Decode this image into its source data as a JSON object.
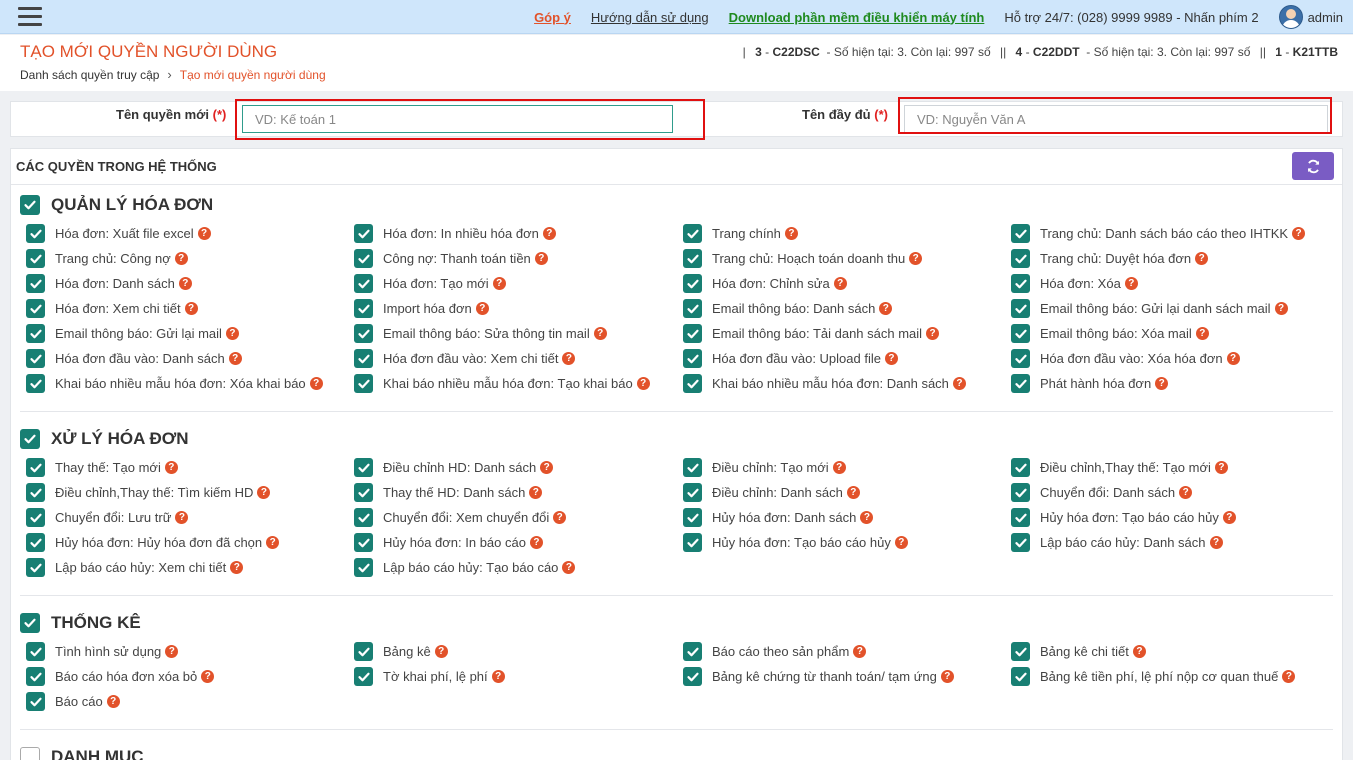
{
  "topbar": {
    "gopy": "Góp ý",
    "huong_dan": "Hướng dẫn sử dụng",
    "download": "Download phần mềm điều khiển máy tính",
    "support": "Hỗ trợ 24/7: (028) 9999 9989 - Nhấn phím 2",
    "user": "admin"
  },
  "header": {
    "title": "Tạo mới quyền người dùng",
    "breadcrumb_home": "Danh sách quyền truy cập",
    "breadcrumb_current": "Tạo mới quyền người dùng",
    "series": [
      {
        "no": "3",
        "code": "C22DSC",
        "info": "- Số hiện tại: 3. Còn lại: 997 số"
      },
      {
        "no": "4",
        "code": "C22DDT",
        "info": "- Số hiện tại: 3. Còn lại: 997 số"
      },
      {
        "no": "1",
        "code": "K21TTB",
        "info": ""
      }
    ]
  },
  "form": {
    "role_label": "Tên quyền mới",
    "role_placeholder": "VD: Kế toán 1",
    "fullname_label": "Tên đầy đủ",
    "fullname_placeholder": "VD: Nguyễn Văn A",
    "required_mark": "(*)"
  },
  "panel": {
    "title": "Các quyền trong hệ thống",
    "groups": [
      {
        "name": "Quản lý hóa đơn",
        "checked": true,
        "items": [
          "Hóa đơn: Xuất file excel",
          "Hóa đơn: In nhiều hóa đơn",
          "Trang chính",
          "Trang chủ: Danh sách báo cáo theo IHTKK",
          "Trang chủ: Công nợ",
          "Công nợ: Thanh toán tiền",
          "Trang chủ: Hoạch toán doanh thu",
          "Trang chủ: Duyệt hóa đơn",
          "Hóa đơn: Danh sách",
          "Hóa đơn: Tạo mới",
          "Hóa đơn: Chỉnh sửa",
          "Hóa đơn: Xóa",
          "Hóa đơn: Xem chi tiết",
          "Import hóa đơn",
          "Email thông báo: Danh sách",
          "Email thông báo: Gửi lại danh sách mail",
          "Email thông báo: Gửi lại mail",
          "Email thông báo: Sửa thông tin mail",
          "Email thông báo: Tải danh sách mail",
          "Email thông báo: Xóa mail",
          "Hóa đơn đầu vào: Danh sách",
          "Hóa đơn đầu vào: Xem chi tiết",
          "Hóa đơn đầu vào: Upload file",
          "Hóa đơn đầu vào: Xóa hóa đơn",
          "Khai báo nhiều mẫu hóa đơn: Xóa khai báo",
          "Khai báo nhiều mẫu hóa đơn: Tạo khai báo",
          "Khai báo nhiều mẫu hóa đơn: Danh sách",
          "Phát hành hóa đơn"
        ]
      },
      {
        "name": "Xử lý hóa đơn",
        "checked": true,
        "items": [
          "Thay thế: Tạo mới",
          "Điều chỉnh HD: Danh sách",
          "Điều chỉnh: Tạo mới",
          "Điều chỉnh,Thay thế: Tạo mới",
          "Điều chỉnh,Thay thế: Tìm kiếm HD",
          "Thay thế HD: Danh sách",
          "Điều chỉnh: Danh sách",
          "Chuyển đổi: Danh sách",
          "Chuyển đổi: Lưu trữ",
          "Chuyển đổi: Xem chuyển đổi",
          "Hủy hóa đơn: Danh sách",
          "Hủy hóa đơn: Tạo báo cáo hủy",
          "Hủy hóa đơn: Hủy hóa đơn đã chọn",
          "Hủy hóa đơn: In báo cáo",
          "Hủy hóa đơn: Tạo báo cáo hủy",
          "Lập báo cáo hủy: Danh sách",
          "Lập báo cáo hủy: Xem chi tiết",
          "Lập báo cáo hủy: Tạo báo cáo"
        ]
      },
      {
        "name": "Thống kê",
        "checked": true,
        "items": [
          "Tình hình sử dụng",
          "Bảng kê",
          "Báo cáo theo sản phẩm",
          "Bảng kê chi tiết",
          "Báo cáo hóa đơn xóa bỏ",
          "Tờ khai phí, lệ phí",
          "Bảng kê chứng từ thanh toán/ tạm ứng",
          "Bảng kê tiền phí, lệ phí nộp cơ quan thuế",
          "Báo cáo"
        ]
      },
      {
        "name": "Danh mục",
        "checked": false,
        "items": []
      }
    ]
  }
}
